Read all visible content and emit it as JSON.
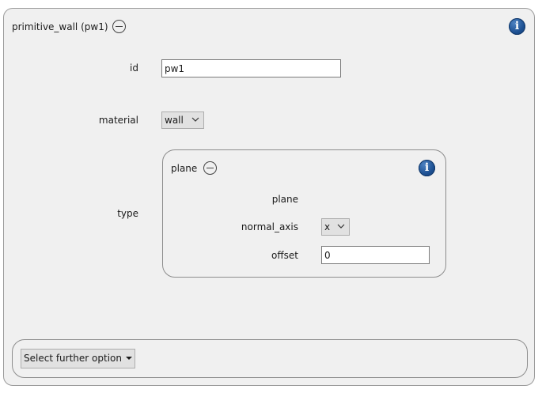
{
  "panel": {
    "title": "primitive_wall (pw1)",
    "fields": {
      "id_label": "id",
      "id_value": "pw1",
      "material_label": "material",
      "material_value": "wall",
      "type_label": "type"
    }
  },
  "type_panel": {
    "title": "plane",
    "plane_label": "plane",
    "normal_axis_label": "normal_axis",
    "normal_axis_value": "x",
    "offset_label": "offset",
    "offset_value": "0"
  },
  "footer": {
    "select_option_label": "Select further option"
  },
  "icons": {
    "info": "info-icon",
    "collapse": "collapse-icon",
    "chevron": "chevron-down-icon",
    "caret": "caret-down-icon"
  },
  "colors": {
    "panel_bg": "#f0f0f0",
    "info_blue": "#1c4f91",
    "border": "#8c8c8c"
  }
}
